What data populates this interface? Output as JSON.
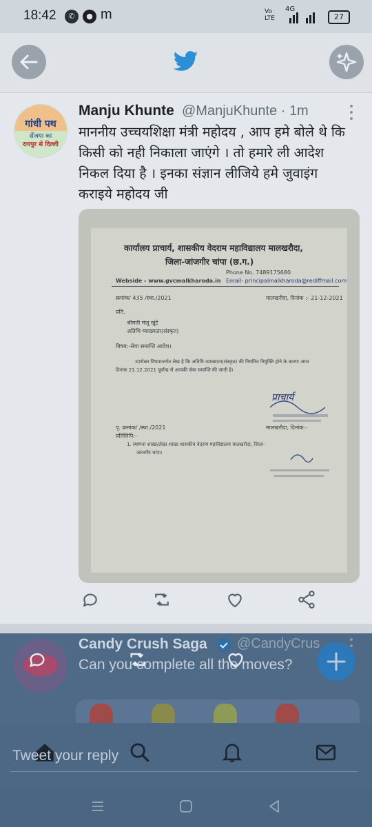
{
  "status_bar": {
    "time": "18:42",
    "network": "4G",
    "battery": "27",
    "app_icon_letter": "m",
    "volte": "Vo LTE"
  },
  "header": {
    "back_icon": "arrow-left-icon",
    "logo_icon": "twitter-bird-icon",
    "sparkle_icon": "sparkle-icon"
  },
  "tweet": {
    "author_name": "Manju Khunte",
    "author_handle": "@ManjuKhunte · 1m",
    "avatar_text": {
      "line1": "गांधी पथ",
      "line2": "सेंजया का",
      "line3": "रायपुर से दिल्ली"
    },
    "text": "माननीय उच्चयशिक्षा मंत्री  महोदय , आप हमे बोले थे कि  किसी को नही निकाला जाएंगे । तो हमारे ली आदेश निकल दिया है । इनका संज्ञान लीजिये हमे जुवाइंग कराइये  महोदय जी",
    "document": {
      "heading1": "कार्यालय प्राचार्य, शासकीय वेदराम महाविद्यालय मालखरौदा,",
      "heading2": "जिला-जांजगीर चांपा (छ.ग.)",
      "phone": "Phone No. 7489175680",
      "website": "Webside - www.gvcmalkharoda.in",
      "email": "Email- principalmalkharoda@rediffmail.com",
      "ref_no": "क्रमांक/ 435 /स्था./2021",
      "place_date": "मालखरौदा, दिनांक :- 21-12-2021",
      "to_label": "प्रति,",
      "to_name": "श्रीमती मंजू खूंटे",
      "to_role": "अतिथि व्याख्याता(संस्कृत)",
      "subject": "विषय:-सेवा समाप्ति आदेश।",
      "body1": "उपरोक्त विषयान्तर्गत लेख है कि अतिथि व्याख्याता(संस्कृत) की नियमित नियुक्ति होने के कारण आज",
      "body2": "दिनांक 21.12.2021 पूर्वान्ह से आपकी सेवा समाप्ति की जाती है।",
      "signature": "प्राचार्य",
      "endorse_no": "पृ. क्रमांक/          /स्था./2021",
      "endorse_place": "मालखरौदा, दिनांक:-",
      "copy_label": "प्रतिलिपि:-",
      "copy_item1": "1.  स्थापना शाखा/लेखा शाखा शासकीय वेदराम महाविद्यालय मालखरौदा, जिला-",
      "copy_item2": "जांजगीर चांपा।"
    },
    "actions": [
      "reply-icon",
      "retweet-icon",
      "like-icon",
      "share-icon"
    ]
  },
  "promoted": {
    "author_name": "Candy Crush Saga",
    "author_handle": "@CandyCrus",
    "text": "Can you complete all the moves?",
    "verified": true
  },
  "reply_bar": {
    "placeholder": "Tweet your reply"
  },
  "bottom_nav": [
    "home-icon",
    "search-icon",
    "notifications-icon",
    "messages-icon"
  ],
  "system_nav": [
    "recents-icon",
    "home-circle-icon",
    "back-triangle-icon"
  ],
  "colors": {
    "twitter_blue": "#1d9bf0",
    "overlay_blue": "#4c6884",
    "fab_blue": "#2d78b8"
  }
}
